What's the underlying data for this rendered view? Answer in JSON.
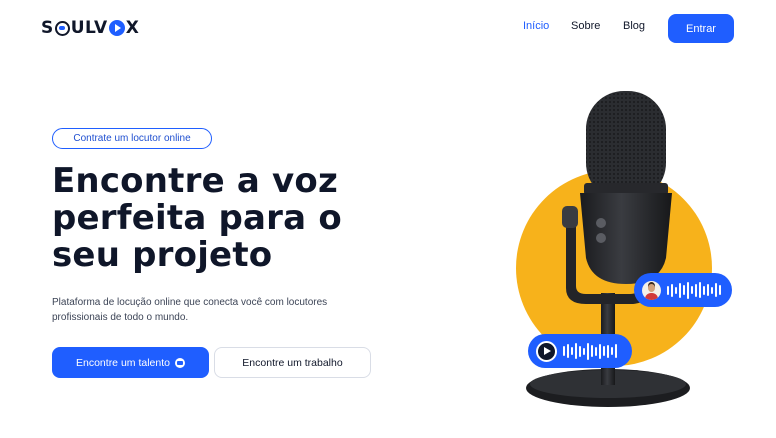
{
  "header": {
    "logo": {
      "part1": "S",
      "part2": "ULV",
      "part3": "X"
    },
    "nav": [
      {
        "label": "Início",
        "active": true
      },
      {
        "label": "Sobre",
        "active": false
      },
      {
        "label": "Blog",
        "active": false
      }
    ],
    "cta_label": "Entrar"
  },
  "hero": {
    "badge": "Contrate um locutor online",
    "headline_lines": [
      "Encontre a voz",
      "perfeita para o",
      "seu projeto"
    ],
    "subtitle_lines": [
      "Plataforma de locução online que conecta você com locutores",
      "profissionais de todo o mundo."
    ],
    "primary_button": "Encontre um talento",
    "secondary_button": "Encontre um trabalho"
  },
  "illustration": {
    "icons": [
      "microphone",
      "user-avatar-icon",
      "play-icon",
      "audio-wave-icon"
    ]
  },
  "colors": {
    "accent": "#1f5eff",
    "circle": "#f7b21b",
    "text": "#10172a"
  }
}
